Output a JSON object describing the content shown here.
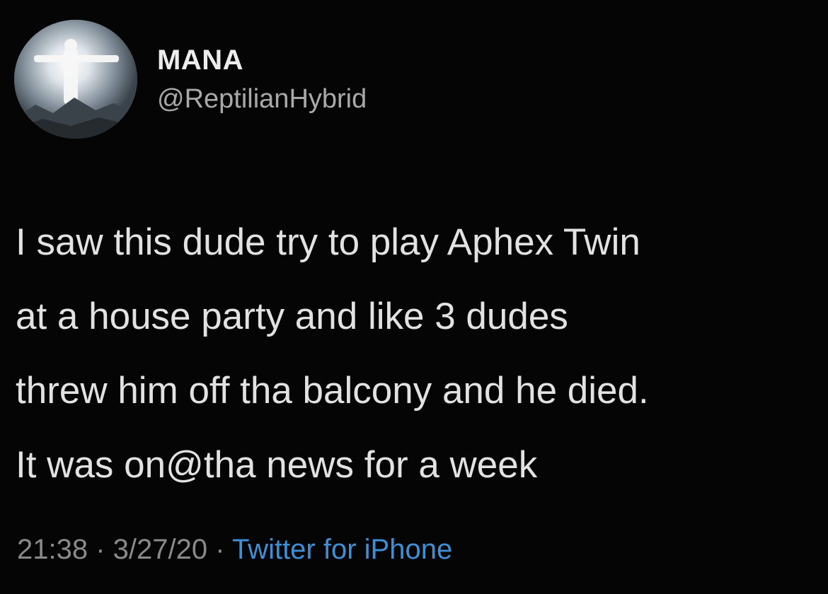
{
  "tweet": {
    "author": {
      "display_name": "MANA",
      "handle": "@ReptilianHybrid",
      "avatar_icon": "statue-on-mountain-avatar"
    },
    "text_lines": [
      "I saw this dude try to play Aphex Twin",
      "at a house party and like 3 dudes",
      "threw him off tha balcony and he died.",
      "It was on@tha news for a week"
    ],
    "meta": {
      "time": "21:38",
      "separator": " · ",
      "date": "3/27/20",
      "source": "Twitter for iPhone"
    },
    "colors": {
      "background": "#050505",
      "text": "#e2e2e2",
      "muted": "#8a8a8a",
      "link": "#3f8fd6"
    }
  }
}
